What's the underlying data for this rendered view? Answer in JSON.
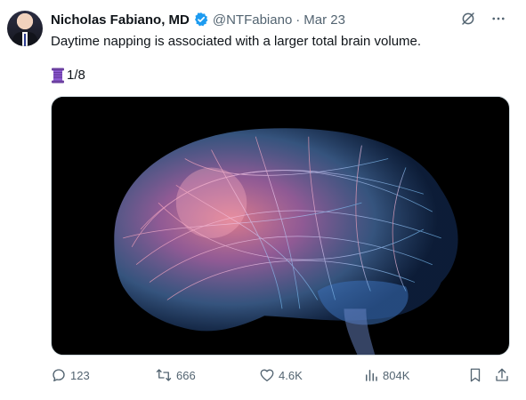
{
  "tweet": {
    "author_name": "Nicholas Fabiano, MD",
    "handle": "@NTFabiano",
    "separator": "·",
    "date": "Mar 23",
    "text": "Daytime napping is associated with a larger total brain volume.",
    "thread_count": "1/8",
    "media_icon": "brain-image",
    "accent_color": "#1d9bf0"
  },
  "actions": {
    "replies": "123",
    "retweets": "666",
    "likes": "4.6K",
    "views": "804K"
  }
}
